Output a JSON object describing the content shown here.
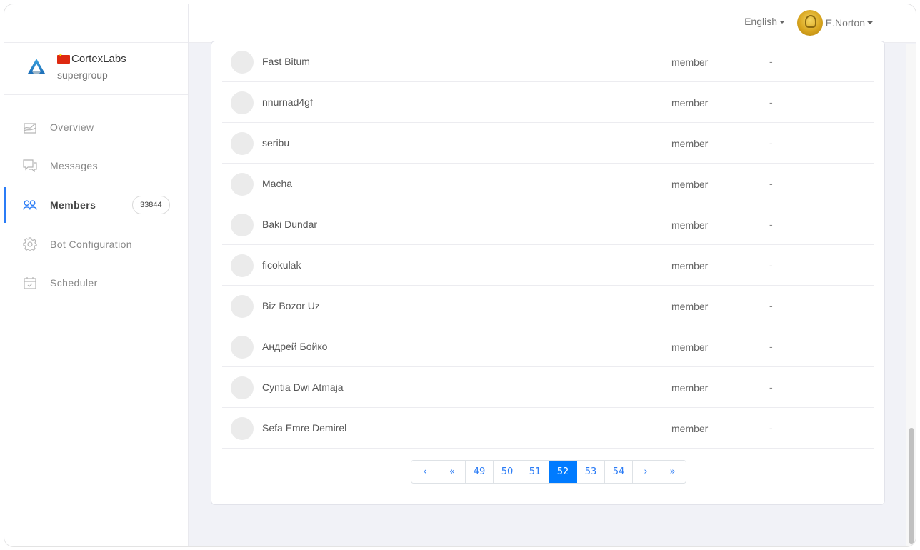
{
  "header": {
    "language": "English",
    "user_name": "E.Norton"
  },
  "brand": {
    "flag": "china-flag",
    "name": "CortexLabs",
    "type": "supergroup"
  },
  "sidebar": {
    "items": [
      {
        "label": "Overview",
        "icon": "chart-icon",
        "active": false
      },
      {
        "label": "Messages",
        "icon": "chat-icon",
        "active": false
      },
      {
        "label": "Members",
        "icon": "users-icon",
        "active": true,
        "badge": "33844"
      },
      {
        "label": "Bot Configuration",
        "icon": "gear-icon",
        "active": false
      },
      {
        "label": "Scheduler",
        "icon": "calendar-check-icon",
        "active": false
      }
    ]
  },
  "members": [
    {
      "name": "Fast Bitum",
      "role": "member",
      "extra": "-"
    },
    {
      "name": "nnurnad4gf",
      "role": "member",
      "extra": "-"
    },
    {
      "name": "seribu",
      "role": "member",
      "extra": "-"
    },
    {
      "name": "Macha",
      "role": "member",
      "extra": "-"
    },
    {
      "name": "Baki Dundar",
      "role": "member",
      "extra": "-"
    },
    {
      "name": "ficokulak",
      "role": "member",
      "extra": "-"
    },
    {
      "name": "Biz Bozor Uz",
      "role": "member",
      "extra": "-"
    },
    {
      "name": "Андрей Бойко",
      "role": "member",
      "extra": "-"
    },
    {
      "name": "Cyntia Dwi Atmaja",
      "role": "member",
      "extra": "-"
    },
    {
      "name": "Sefa Emre Demirel",
      "role": "member",
      "extra": "-"
    }
  ],
  "pagination": {
    "prev": "‹",
    "first": "«",
    "pages": [
      "49",
      "50",
      "51",
      "52",
      "53",
      "54"
    ],
    "current": "52",
    "next": "›",
    "last": "»"
  },
  "colors": {
    "accent": "#007bff",
    "active_nav": "#2b7cf6"
  }
}
